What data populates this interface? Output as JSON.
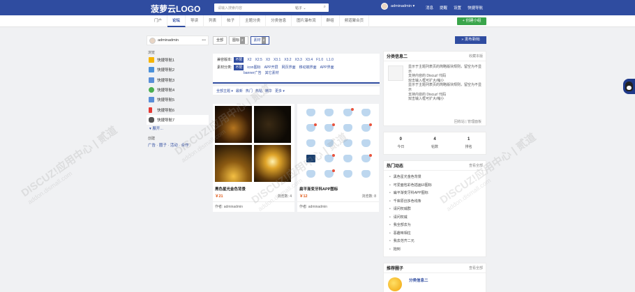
{
  "header": {
    "logo": "菠萝云LOGO",
    "search_placeholder": "请输入搜索内容",
    "search_scope": "帖子 ⌄",
    "username": "adminadmin ▾",
    "nav": [
      "消息",
      "提醒",
      "设置",
      "快捷导航"
    ]
  },
  "subnav": {
    "items": [
      "门户",
      "论坛",
      "导读",
      "列表",
      "帖子",
      "主题分类",
      "分类信息",
      "图片瀑布流",
      "群组",
      "频道聚合页"
    ],
    "active_index": 1,
    "create_label": "+ 创建小组"
  },
  "sidebar": {
    "username": "adminadmin",
    "dots": "•••",
    "section_title": "浏览",
    "items": [
      {
        "label": "快捷导航1",
        "color": "#f5b400"
      },
      {
        "label": "快捷导航2",
        "color": "#4a90d9"
      },
      {
        "label": "快捷导航3",
        "color": "#5a8ed8"
      },
      {
        "label": "快捷导航4",
        "color": "#4caf50"
      },
      {
        "label": "快捷导航5",
        "color": "#5a8ed8"
      },
      {
        "label": "快捷导航6",
        "color": "#e53935"
      },
      {
        "label": "快捷导航7",
        "color": "#555555"
      }
    ],
    "more_label": "▾ 展开...",
    "create_title": "创建",
    "create_links": "广告 · 圈子 · 活动 · 合作"
  },
  "main": {
    "tabs": [
      {
        "label": "全部",
        "count": ""
      },
      {
        "label": "图标",
        "count": "2"
      },
      {
        "label": "素材",
        "count": "2"
      }
    ],
    "filter1": {
      "label": "兼容版本:",
      "options": [
        "不限",
        "X2",
        "X2.5",
        "X3",
        "X3.1",
        "X3.2",
        "X3.3",
        "X3.4",
        "F1.0",
        "L1.0"
      ]
    },
    "filter2": {
      "label": "素材分类:",
      "options": [
        "不限",
        "icon图标",
        "APP开屏",
        "网页界面",
        "移动端界面",
        "APP界面",
        "banner广告",
        "其它素材"
      ]
    },
    "sort": [
      "全部主题 ▾",
      "最新",
      "热门",
      "热帖",
      "精华",
      "更多 ▾"
    ],
    "cards": [
      {
        "title": "黑色星光金色背景",
        "price": "￥21",
        "views": "浏览数: 4",
        "author": "作者: adminadmin"
      },
      {
        "title": "扁平渐变牙科APP图标",
        "price": "￥12",
        "views": "浏览数: 8",
        "author": "作者: adminadmin"
      }
    ]
  },
  "right": {
    "post_label": "» 发布新帖",
    "info": {
      "title": "分类信息二",
      "more": "收藏本版",
      "lines": [
        "显示于主题列表页的简略版块规则，留空为不显示",
        "支持内容的 Discuz! 代码",
        "双击输入框可扩大/缩小",
        "显示于主题列表页的简略版块规则，留空为不显示",
        "支持内容的 Discuz! 代码",
        "双击输入框可扩大/缩小"
      ],
      "footer": "回收站 | 管理面板"
    },
    "stats": [
      {
        "value": "0",
        "label": "今日"
      },
      {
        "value": "4",
        "label": "帖数"
      },
      {
        "value": "1",
        "label": "排名"
      }
    ],
    "hot": {
      "title": "热门动态",
      "more": "查看全部",
      "items": [
        "黑色星光金色背景",
        "可爱面包彩色插画UI图标",
        "扁平渐变牙科APP图标",
        "千库原创多色线条",
        "请问权威群",
        "请问权威",
        "我全部去为",
        "恶趣味相往",
        "我去范齐二元",
        "抱到"
      ]
    },
    "recommend": {
      "title": "推荐圈子",
      "more": "查看全部",
      "name": "分类信息二"
    }
  },
  "watermark": {
    "main": "DISCUZ!应用中心 | 贰道",
    "sub": "addon.dismall.com"
  }
}
